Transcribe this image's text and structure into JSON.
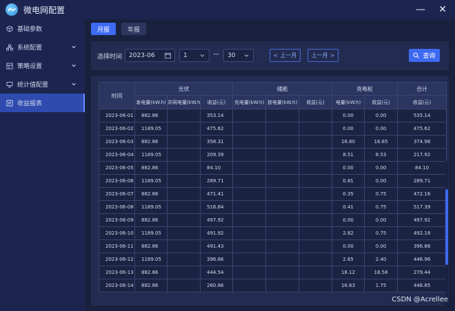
{
  "app": {
    "title": "微电网配置",
    "min_symbol": "—",
    "close_symbol": "✕"
  },
  "sidebar": {
    "items": [
      {
        "label": "基础参数",
        "icon": "cube-icon",
        "has_chevron": false,
        "active": false
      },
      {
        "label": "系统配置",
        "icon": "network-icon",
        "has_chevron": true,
        "active": false
      },
      {
        "label": "策略设置",
        "icon": "grid-icon",
        "has_chevron": true,
        "active": false
      },
      {
        "label": "统计值配置",
        "icon": "shield-icon",
        "has_chevron": true,
        "active": false
      },
      {
        "label": "收益报表",
        "icon": "report-icon",
        "has_chevron": false,
        "active": true
      }
    ]
  },
  "tabs": {
    "month": "月报",
    "year": "年报"
  },
  "filter": {
    "label": "选择时间",
    "month_value": "2023-06",
    "start_day": "1",
    "end_day": "30",
    "dash": "—",
    "prev_label": "上一月",
    "next_label": "上一月",
    "query_label": "查询"
  },
  "table": {
    "time_header": "时间",
    "groups": [
      "光伏",
      "储能",
      "充电桩",
      "合计"
    ],
    "subheaders": [
      "发电量(kW.h)",
      "并网电量(kW.h)",
      "收益(元)",
      "充电量(kW.h)",
      "放电量(kW.h)",
      "收益(元)",
      "电量(kW.h)",
      "收益(元)",
      "收益(元)"
    ],
    "rows": [
      [
        "2023-06-01",
        "882.86",
        "",
        "353.14",
        "",
        "",
        "",
        "0.00",
        "0.00",
        "535.14"
      ],
      [
        "2023-06-02",
        "1189.05",
        "",
        "475.62",
        "",
        "",
        "",
        "0.00",
        "0.00",
        "475.62"
      ],
      [
        "2023-06-03",
        "882.86",
        "",
        "358.31",
        "",
        "",
        "",
        "16.80",
        "16.65",
        "374.96"
      ],
      [
        "2023-06-04",
        "1189.05",
        "",
        "209.39",
        "",
        "",
        "",
        "8.51",
        "8.53",
        "217.92"
      ],
      [
        "2023-06-05",
        "882.86",
        "",
        "84.10",
        "",
        "",
        "",
        "0.00",
        "0.00",
        "84.10"
      ],
      [
        "2023-06-06",
        "1189.05",
        "",
        "289.71",
        "",
        "",
        "",
        "0.81",
        "0.00",
        "289.71"
      ],
      [
        "2023-06-07",
        "882.86",
        "",
        "471.41",
        "",
        "",
        "",
        "0.35",
        "0.75",
        "472.16"
      ],
      [
        "2023-06-08",
        "1189.05",
        "",
        "516.64",
        "",
        "",
        "",
        "0.41",
        "0.75",
        "517.39"
      ],
      [
        "2023-06-09",
        "882.86",
        "",
        "497.92",
        "",
        "",
        "",
        "0.00",
        "0.00",
        "497.92"
      ],
      [
        "2023-06-10",
        "1189.05",
        "",
        "491.92",
        "",
        "",
        "",
        "2.82",
        "0.75",
        "492.18"
      ],
      [
        "2023-06-11",
        "882.86",
        "",
        "491.43",
        "",
        "",
        "",
        "0.00",
        "0.00",
        "396.86"
      ],
      [
        "2023-06-12",
        "1189.05",
        "",
        "396.86",
        "",
        "",
        "",
        "2.65",
        "2.40",
        "446.96"
      ],
      [
        "2023-06-13",
        "882.86",
        "",
        "444.54",
        "",
        "",
        "",
        "18.12",
        "18.58",
        "279.44"
      ],
      [
        "2023-06-14",
        "882.86",
        "",
        "260.86",
        "",
        "",
        "",
        "16.63",
        "1.75",
        "446.85"
      ]
    ]
  },
  "watermark": "CSDN @Acrellee",
  "colors": {
    "accent": "#3e6af2",
    "bg": "#1a2240",
    "panel": "#222c50"
  }
}
